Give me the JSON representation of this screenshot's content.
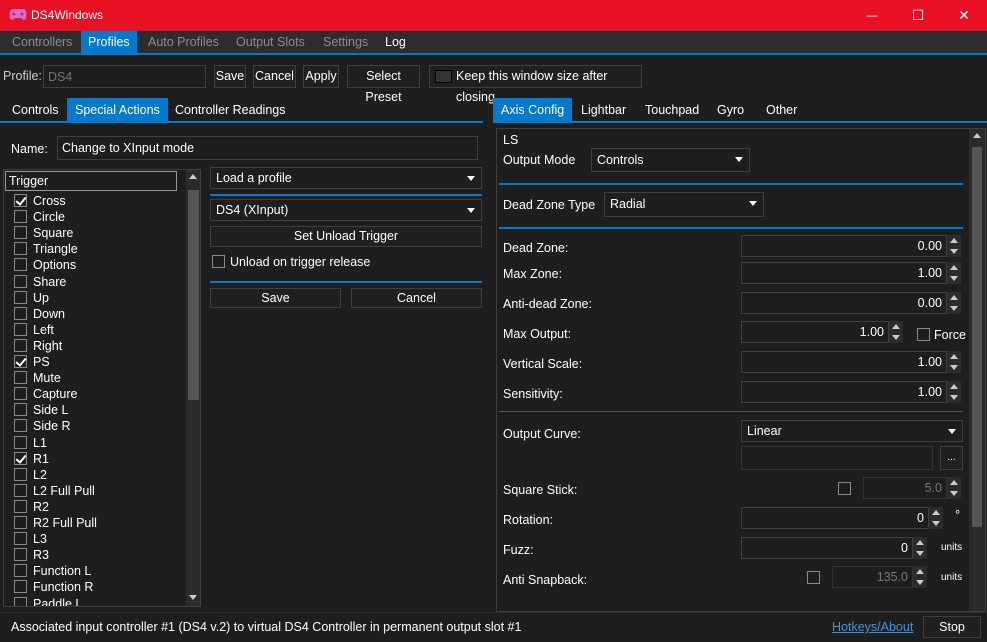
{
  "window": {
    "title": "DS4Windows",
    "minimize": "—",
    "maximize": "☐",
    "close": "✕",
    "accent": "#e81123"
  },
  "main_tabs": [
    "Controllers",
    "Profiles",
    "Auto Profiles",
    "Output Slots",
    "Settings",
    "Log"
  ],
  "profile": {
    "label": "Profile:",
    "name_placeholder": "DS4",
    "save": "Save",
    "cancel": "Cancel",
    "apply": "Apply",
    "select_preset": "Select Preset",
    "keep_size": "Keep this window size after closing"
  },
  "left_tabs": [
    "Controls",
    "Special Actions",
    "Controller Readings"
  ],
  "action": {
    "name_label": "Name:",
    "name_value": "Change to XInput mode",
    "trigger_header": "Trigger",
    "triggers": [
      {
        "label": "Cross",
        "checked": true
      },
      {
        "label": "Circle",
        "checked": false
      },
      {
        "label": "Square",
        "checked": false
      },
      {
        "label": "Triangle",
        "checked": false
      },
      {
        "label": "Options",
        "checked": false
      },
      {
        "label": "Share",
        "checked": false
      },
      {
        "label": "Up",
        "checked": false
      },
      {
        "label": "Down",
        "checked": false
      },
      {
        "label": "Left",
        "checked": false
      },
      {
        "label": "Right",
        "checked": false
      },
      {
        "label": "PS",
        "checked": true
      },
      {
        "label": "Mute",
        "checked": false
      },
      {
        "label": "Capture",
        "checked": false
      },
      {
        "label": "Side L",
        "checked": false
      },
      {
        "label": "Side R",
        "checked": false
      },
      {
        "label": "L1",
        "checked": false
      },
      {
        "label": "R1",
        "checked": true
      },
      {
        "label": "L2",
        "checked": false
      },
      {
        "label": "L2 Full Pull",
        "checked": false
      },
      {
        "label": "R2",
        "checked": false
      },
      {
        "label": "R2 Full Pull",
        "checked": false
      },
      {
        "label": "L3",
        "checked": false
      },
      {
        "label": "R3",
        "checked": false
      },
      {
        "label": "Function L",
        "checked": false
      },
      {
        "label": "Function R",
        "checked": false
      },
      {
        "label": "Paddle L",
        "checked": false
      }
    ],
    "action_type": "Load a profile",
    "profile_select": "DS4 (XInput)",
    "set_unload": "Set Unload Trigger",
    "unload_release": "Unload on trigger release",
    "save": "Save",
    "cancel": "Cancel"
  },
  "right_tabs": [
    "Axis Config",
    "Lightbar",
    "Touchpad",
    "Gyro",
    "Other"
  ],
  "axis": {
    "group": "LS",
    "output_mode_label": "Output Mode",
    "output_mode": "Controls",
    "dz_type_label": "Dead Zone Type",
    "dz_type": "Radial",
    "rows": [
      {
        "label": "Dead Zone:",
        "value": "0.00"
      },
      {
        "label": "Max Zone:",
        "value": "1.00"
      },
      {
        "label": "Anti-dead Zone:",
        "value": "0.00"
      },
      {
        "label": "Max Output:",
        "value": "1.00"
      },
      {
        "label": "Vertical Scale:",
        "value": "1.00"
      },
      {
        "label": "Sensitivity:",
        "value": "1.00"
      }
    ],
    "force": "Force",
    "curve_label": "Output Curve:",
    "curve": "Linear",
    "ellipsis": "...",
    "square_label": "Square Stick:",
    "square_value": "5.0",
    "rotation_label": "Rotation:",
    "rotation_value": "0",
    "degree": "°",
    "fuzz_label": "Fuzz:",
    "fuzz_value": "0",
    "units": "units",
    "snap_label": "Anti Snapback:",
    "snap_value": "135.0",
    "snap_units": "units"
  },
  "status": {
    "message": "Associated input controller #1 (DS4 v.2) to virtual DS4 Controller in permanent output slot #1",
    "hotkeys": "Hotkeys/About",
    "stop": "Stop"
  }
}
